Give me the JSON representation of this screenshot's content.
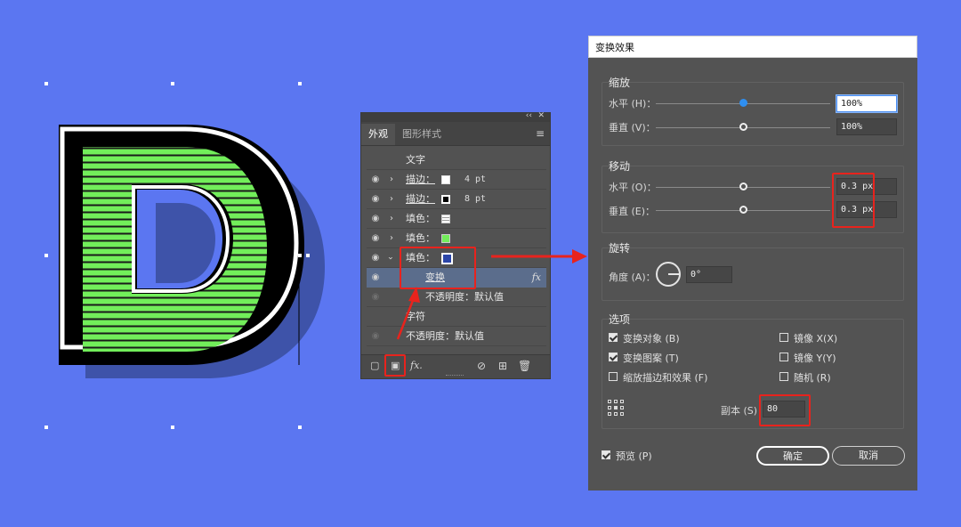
{
  "colors": {
    "background": "#5b76f1",
    "letter_fill": "#72ee5a",
    "letter_stripes": "#1a1a1a",
    "letter_outline": "#ffffff",
    "letter_shadow": "#3e53a9",
    "highlight_red": "#e8231d",
    "panel_bg": "#525252",
    "selected_row": "#5b6d8c"
  },
  "artwork": {
    "letter": "D"
  },
  "appearance_panel": {
    "tabs": [
      {
        "label": "外观",
        "active": true
      },
      {
        "label": "图形样式",
        "active": false
      }
    ],
    "collapse_icon": "double-chevron-icon",
    "close_icon": "close-icon",
    "menu_icon": "hamburger-menu-icon",
    "header": "文字",
    "rows": [
      {
        "label": "描边：",
        "value": "4 pt",
        "swatch": "#ffffff"
      },
      {
        "label": "描边：",
        "value": "8 pt",
        "swatch": "#000000"
      },
      {
        "label": "填色：",
        "swatch": "#ffffff",
        "swatch_style": "striped"
      },
      {
        "label": "填色：",
        "swatch": "#72ee5a"
      },
      {
        "label": "填色：",
        "swatch": "#2b45a8",
        "expanded": true
      },
      {
        "label": "变换",
        "effect": "fx"
      },
      {
        "label": "不透明度：默认值"
      },
      {
        "label": "字符"
      },
      {
        "label": "不透明度：默认值"
      }
    ],
    "bottom_icons": [
      "new-stroke-icon",
      "new-fill-icon",
      "add-effect-fx-icon",
      "clear-appearance-icon",
      "duplicate-item-icon",
      "delete-icon"
    ],
    "fx_label": "fx."
  },
  "dialog": {
    "title": "变换效果",
    "scale": {
      "group_label": "缩放",
      "horizontal_label": "水平 (H)：",
      "horizontal_value": "100%",
      "horizontal_slider": 0.5,
      "vertical_label": "垂直 (V)：",
      "vertical_value": "100%",
      "vertical_slider": 0.5
    },
    "move": {
      "group_label": "移动",
      "horizontal_label": "水平 (O)：",
      "horizontal_value": "0.3 px",
      "horizontal_slider": 0.5,
      "vertical_label": "垂直 (E)：",
      "vertical_value": "0.3 px",
      "vertical_slider": 0.5
    },
    "rotate": {
      "group_label": "旋转",
      "angle_label": "角度 (A)：",
      "angle_value": "0°"
    },
    "options": {
      "group_label": "选项",
      "checkboxes": [
        {
          "label": "变换对象 (B)",
          "checked": true
        },
        {
          "label": "镜像 X(X)",
          "checked": false
        },
        {
          "label": "变换图案 (T)",
          "checked": true
        },
        {
          "label": "镜像 Y(Y)",
          "checked": false
        },
        {
          "label": "缩放描边和效果 (F)",
          "checked": false
        },
        {
          "label": "随机 (R)",
          "checked": false
        }
      ],
      "copies_label": "副本 (S)",
      "copies_value": "80",
      "reference_point_icon": "reference-point-grid-icon"
    },
    "preview_label": "预览 (P)",
    "preview_checked": true,
    "ok_label": "确定",
    "cancel_label": "取消"
  }
}
